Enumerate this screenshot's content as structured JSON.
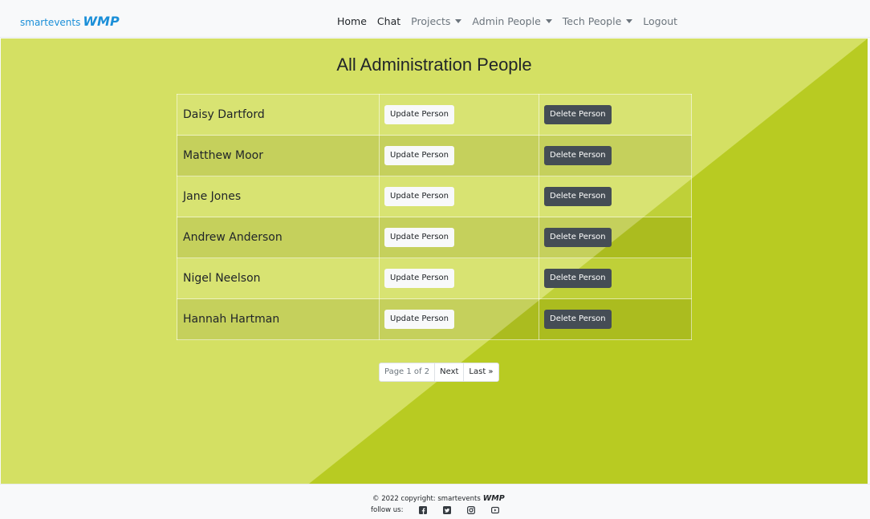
{
  "navbar": {
    "brand_text": "smartevents",
    "brand_logo": "WMP",
    "items": [
      {
        "label": "Home"
      },
      {
        "label": "Chat"
      },
      {
        "label": "Projects"
      },
      {
        "label": "Admin People"
      },
      {
        "label": "Tech People"
      },
      {
        "label": "Logout"
      }
    ]
  },
  "main": {
    "title": "All Administration People",
    "rows": [
      {
        "name": "Daisy Dartford",
        "update_label": "Update Person",
        "delete_label": "Delete Person"
      },
      {
        "name": "Matthew Moor",
        "update_label": "Update Person",
        "delete_label": "Delete Person"
      },
      {
        "name": "Jane Jones",
        "update_label": "Update Person",
        "delete_label": "Delete Person"
      },
      {
        "name": "Andrew Anderson",
        "update_label": "Update Person",
        "delete_label": "Delete Person"
      },
      {
        "name": "Nigel Neelson",
        "update_label": "Update Person",
        "delete_label": "Delete Person"
      },
      {
        "name": "Hannah Hartman",
        "update_label": "Update Person",
        "delete_label": "Delete Person"
      }
    ],
    "pagination": {
      "page_info": "Page 1 of 2",
      "next": "Next",
      "last": "Last »"
    }
  },
  "footer": {
    "copyright": "© 2022 copyright: smartevents",
    "logo": "WMP",
    "follow": "follow us:",
    "social_icons": [
      "facebook-icon",
      "twitter-icon",
      "instagram-icon",
      "youtube-icon"
    ]
  },
  "colors": {
    "background_light": "#d4e063",
    "background_dark": "#b8cb22",
    "delete_button": "#454d55",
    "brand": "#1b8fd8"
  }
}
